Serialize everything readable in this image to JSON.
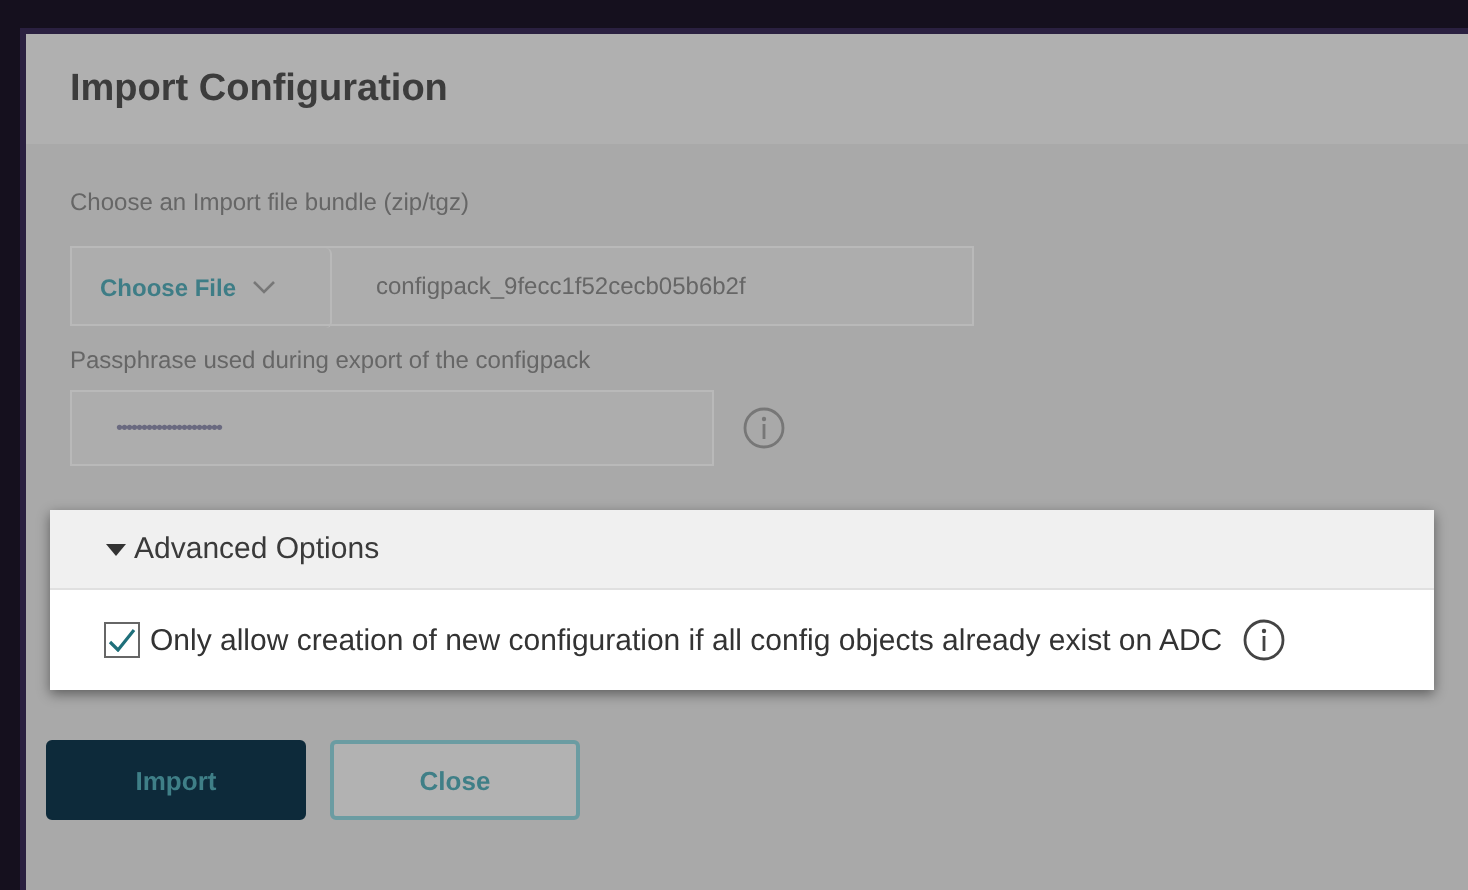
{
  "dialog": {
    "title": "Import Configuration",
    "file_label": "Choose an Import file bundle (zip/tgz)",
    "choose_button": "Choose File",
    "file_name": "configpack_9fecc1f52cecb05b6b2f",
    "passphrase_label": "Passphrase used during export of the configpack",
    "passphrase_value": "•••••••••••••••••••••"
  },
  "advanced_options": {
    "title": "Advanced Options",
    "expanded": true,
    "options": [
      {
        "label": "Only allow creation of new configuration if all config objects already exist on ADC",
        "checked": true
      }
    ]
  },
  "buttons": [
    {
      "label": "Import",
      "kind": "primary"
    },
    {
      "label": "Close",
      "kind": "secondary"
    }
  ]
}
